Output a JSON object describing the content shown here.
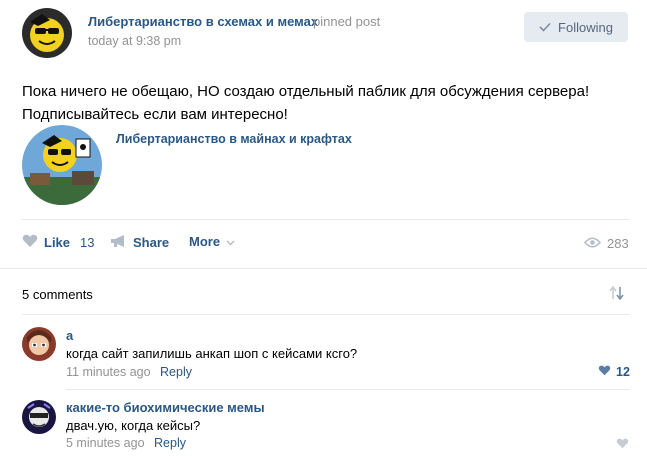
{
  "post": {
    "author": "Либертарианство в схемах и мемах",
    "pinned_label": "pinned post",
    "time": "today at 9:38 pm",
    "follow_label": "Following",
    "text_line1": "Пока ничего не обещаю, НО создаю отдельный паблик для обсуждения сервера!",
    "text_line2": "Подписывайтесь если вам интересно!",
    "attachment_title": "Либертарианство в майнах и крафтах"
  },
  "actions": {
    "like_label": "Like",
    "like_count": "13",
    "share_label": "Share",
    "more_label": "More",
    "views_count": "283"
  },
  "comments": {
    "count_label": "5 comments",
    "items": [
      {
        "author": "a",
        "text": "когда сайт запилишь анкап шоп с кейсами ксго?",
        "time": "11 minutes ago",
        "reply_label": "Reply",
        "likes": "12"
      },
      {
        "author": "какие-то биохимические мемы",
        "text": "двач.ую, когда кейсы?",
        "time": "5 minutes ago",
        "reply_label": "Reply",
        "likes": ""
      }
    ]
  },
  "colors": {
    "link": "#2a5885",
    "muted": "#939393",
    "button_bg": "#e5ebf1",
    "divider": "#e7e8ec"
  }
}
